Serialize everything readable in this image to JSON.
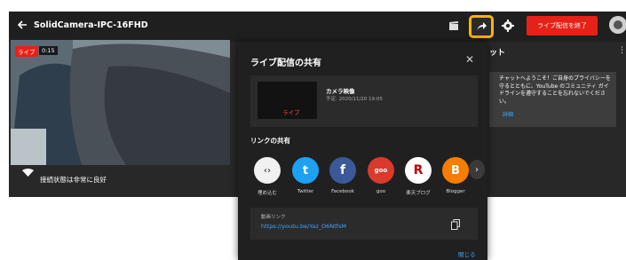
{
  "app": {
    "title": "SolidCamera-IPC-16FHD",
    "end_stream_label": "ライブ配信を終了"
  },
  "preview": {
    "live_badge": "ライブ",
    "elapsed": "0:15",
    "connection_status": "接続状態は非常に良好"
  },
  "chat": {
    "title": "ット",
    "welcome_message": "チャットへようこそ！ご自身のプライバシーを守るとともに、YouTube のコミュニティ ガイドラインを遵守することを忘れないでください。",
    "details_link": "詳細"
  },
  "share_dialog": {
    "title": "ライブ配信の共有",
    "stream_title": "カメラ映像",
    "stream_schedule": "予定: 2020/11/20 19:05",
    "thumbnail_badge": "ライブ",
    "share_section_label": "リンクの共有",
    "targets": [
      {
        "label": "埋め込む",
        "icon": "embed-icon",
        "glyph": "‹›",
        "color": "#f1f1f1"
      },
      {
        "label": "Twitter",
        "icon": "twitter-icon",
        "glyph": "t",
        "color": "#1da1f2"
      },
      {
        "label": "Facebook",
        "icon": "facebook-icon",
        "glyph": "f",
        "color": "#3b5998"
      },
      {
        "label": "goo",
        "icon": "goo-icon",
        "glyph": "goo",
        "color": "#d93a2b"
      },
      {
        "label": "楽天ブログ",
        "icon": "rakuten-icon",
        "glyph": "R",
        "color": "#ffffff"
      },
      {
        "label": "Blogger",
        "icon": "blogger-icon",
        "glyph": "B",
        "color": "#f57d00"
      }
    ],
    "url_caption": "動画リンク",
    "url": "https://youtu.be/Yaz_O6NtfsM",
    "close_label": "閉じる"
  }
}
